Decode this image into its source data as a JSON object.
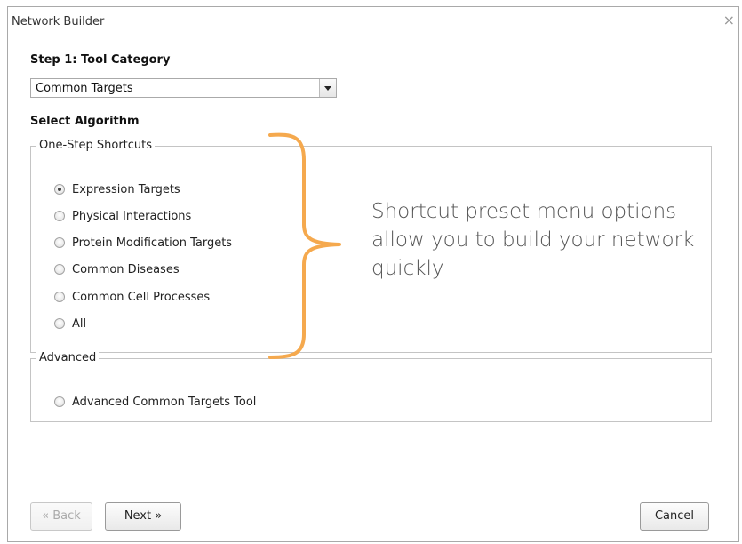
{
  "window": {
    "title": "Network Builder",
    "close_glyph": "×"
  },
  "step1": {
    "label": "Step 1: Tool Category",
    "selected_value": "Common Targets"
  },
  "algorithm": {
    "label": "Select Algorithm"
  },
  "shortcuts": {
    "legend": "One-Step Shortcuts",
    "options": [
      {
        "label": "Expression Targets",
        "checked": true
      },
      {
        "label": "Physical Interactions",
        "checked": false
      },
      {
        "label": "Protein Modification Targets",
        "checked": false
      },
      {
        "label": "Common Diseases",
        "checked": false
      },
      {
        "label": "Common Cell Processes",
        "checked": false
      },
      {
        "label": "All",
        "checked": false
      }
    ]
  },
  "advanced": {
    "legend": "Advanced",
    "options": [
      {
        "label": "Advanced Common Targets Tool",
        "checked": false
      }
    ]
  },
  "annotation": {
    "text": "Shortcut preset menu options allow you to build your network quickly",
    "color": "#f5a94e"
  },
  "buttons": {
    "back": "« Back",
    "next": "Next »",
    "cancel": "Cancel"
  }
}
